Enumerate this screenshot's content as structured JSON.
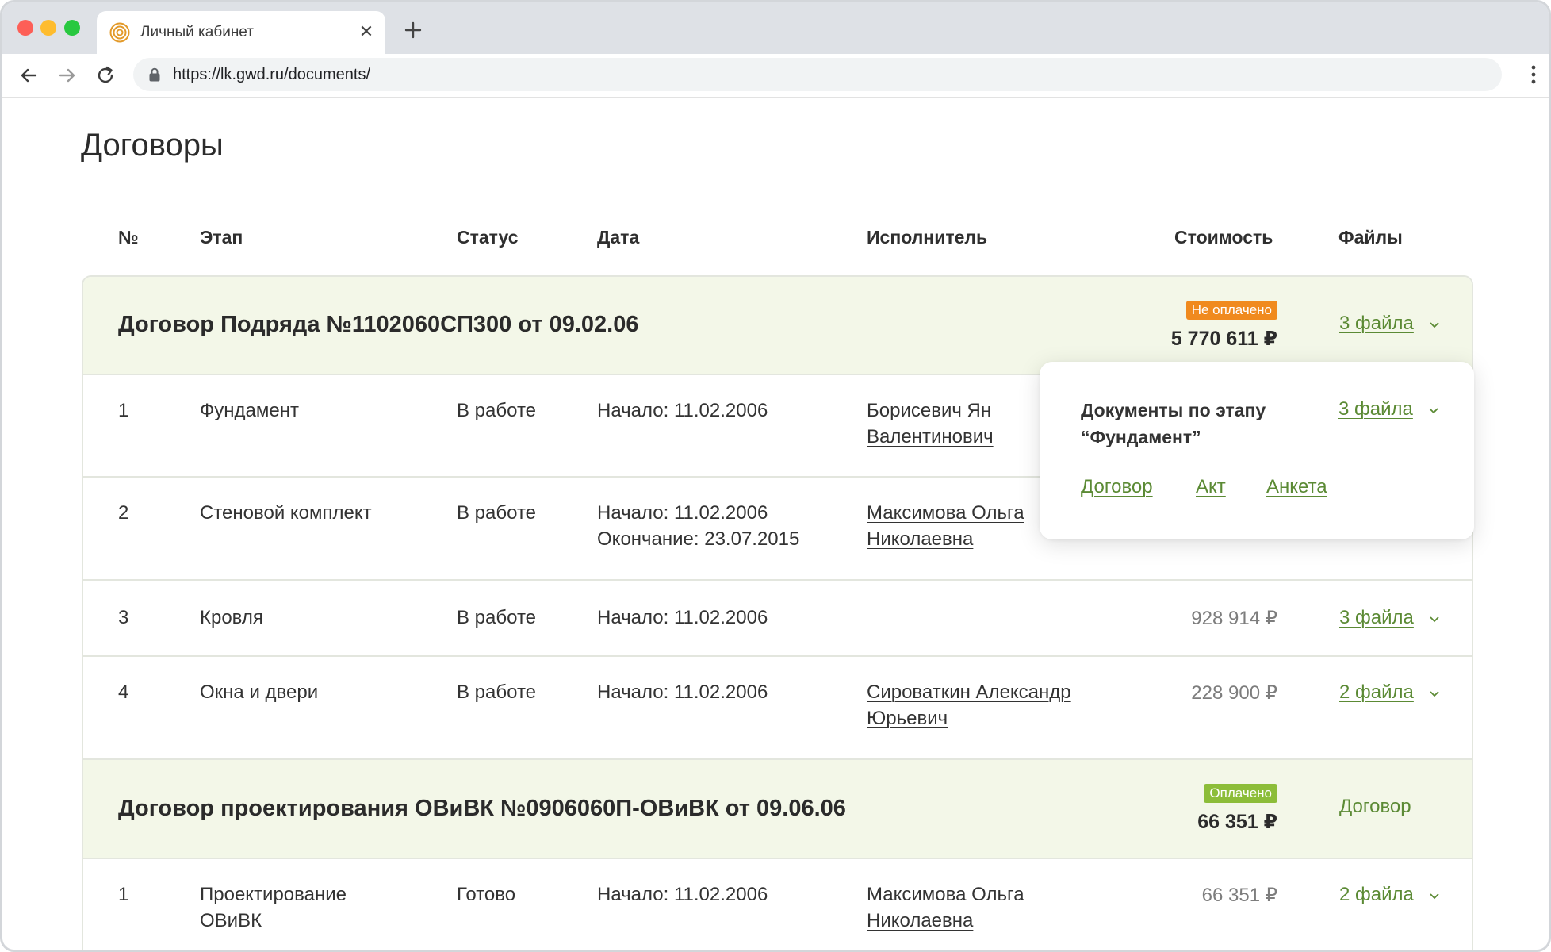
{
  "browser": {
    "tab_title": "Личный кабинет",
    "url": "https://lk.gwd.ru/documents/",
    "icons": [
      "favicon-logo-icon",
      "close-icon",
      "plus-icon",
      "arrow-left-icon",
      "arrow-right-icon",
      "reload-icon",
      "lock-icon",
      "more-vertical-icon"
    ]
  },
  "page": {
    "title": "Договоры"
  },
  "columns": {
    "num": "№",
    "stage": "Этап",
    "status": "Статус",
    "date": "Дата",
    "executor": "Исполнитель",
    "cost": "Стоимость",
    "files": "Файлы"
  },
  "colors": {
    "accent_green": "#5b8a34",
    "group_bg": "#f3f7e8",
    "badge_unpaid": "#f08a1e",
    "badge_paid": "#8cbd39"
  },
  "contracts": [
    {
      "title": "Договор Подряда №1102060СП300 от 09.02.06",
      "badge": "Не оплачено",
      "total": "5 770 611 ₽",
      "files": "3 файла",
      "stages": [
        {
          "num": "1",
          "name": "Фундамент",
          "status": "В работе",
          "start": "Начало: 11.02.2006",
          "executor_line1": "Борисевич Ян",
          "executor_line2": "Валентинович"
        },
        {
          "num": "2",
          "name": "Стеновой комплект",
          "status": "В работе",
          "start": "Начало: 11.02.2006",
          "end": "Окончание: 23.07.2015",
          "executor_line1": "Максимова Ольга",
          "executor_line2": "Николаевна"
        },
        {
          "num": "3",
          "name": "Кровля",
          "status": "В работе",
          "start": "Начало: 11.02.2006",
          "price": "928 914 ₽",
          "files": "3 файла"
        },
        {
          "num": "4",
          "name": "Окна и двери",
          "status": "В работе",
          "start": "Начало: 11.02.2006",
          "executor_line1": "Сироваткин Александр",
          "executor_line2": "Юрьевич",
          "price": "228 900 ₽",
          "files": "2 файла"
        }
      ]
    },
    {
      "title": "Договор проектирования ОВиВК №0906060П-ОВиВК от 09.06.06",
      "badge": "Оплачено",
      "total": "66 351 ₽",
      "files": "Договор",
      "stages": [
        {
          "num": "1",
          "name_line1": "Проектирование",
          "name_line2": "ОВиВК",
          "status": "Готово",
          "start": "Начало: 11.02.2006",
          "executor_line1": "Максимова Ольга",
          "executor_line2": "Николаевна",
          "price": "66 351 ₽",
          "files": "2 файла"
        }
      ]
    }
  ],
  "popup": {
    "title_line1": "Документы по этапу",
    "title_line2": "“Фундамент”",
    "files": "3 файла",
    "links": [
      "Договор",
      "Акт",
      "Анкета"
    ]
  }
}
